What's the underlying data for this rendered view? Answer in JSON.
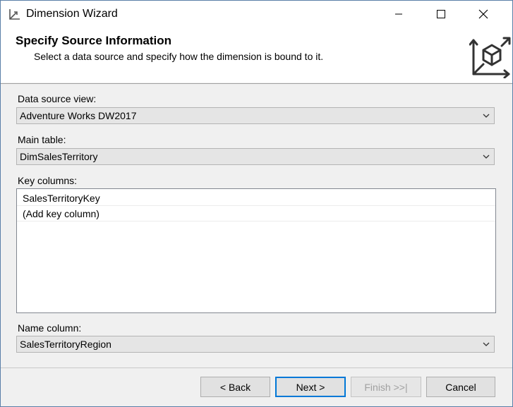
{
  "window": {
    "title": "Dimension Wizard"
  },
  "header": {
    "title": "Specify Source Information",
    "subtitle": "Select a data source and specify how the dimension is bound to it."
  },
  "form": {
    "data_source_view": {
      "label": "Data source view:",
      "value": "Adventure Works DW2017"
    },
    "main_table": {
      "label": "Main table:",
      "value": "DimSalesTerritory"
    },
    "key_columns": {
      "label": "Key columns:",
      "rows": [
        "SalesTerritoryKey",
        "(Add key column)"
      ]
    },
    "name_column": {
      "label": "Name column:",
      "value": "SalesTerritoryRegion"
    }
  },
  "buttons": {
    "back": "< Back",
    "next": "Next >",
    "finish": "Finish >>|",
    "cancel": "Cancel"
  },
  "icons": [
    "wizard-app-icon",
    "minimize-icon",
    "maximize-icon",
    "close-icon",
    "dimension-cube-icon",
    "chevron-down-icon"
  ]
}
